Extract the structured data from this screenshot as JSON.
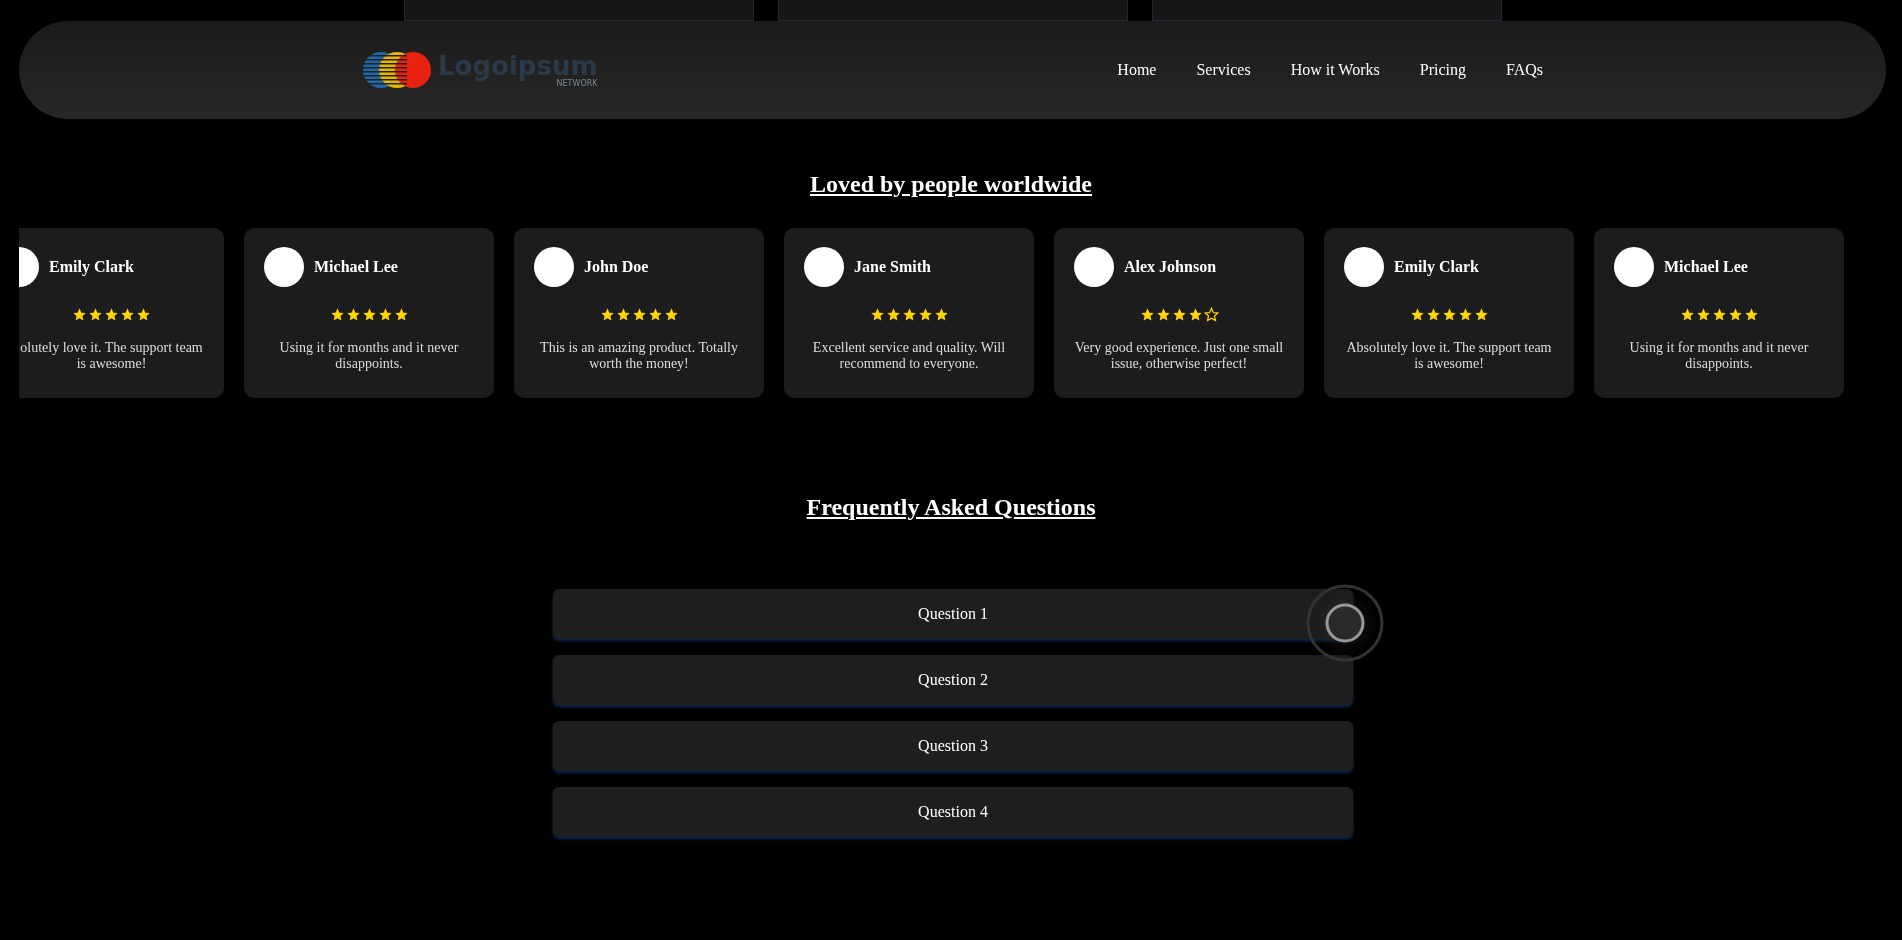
{
  "logo": {
    "name": "Logoipsum",
    "tagline": "NETWORK"
  },
  "nav": [
    {
      "label": "Home"
    },
    {
      "label": "Services"
    },
    {
      "label": "How it Works"
    },
    {
      "label": "Pricing"
    },
    {
      "label": "FAQs"
    }
  ],
  "testimonials": {
    "title": "Loved by people worldwide",
    "items": [
      {
        "name": "Emily Clark",
        "stars": 5,
        "text": "olutely love it. The support team is awesome!",
        "cut": true
      },
      {
        "name": "Michael Lee",
        "stars": 5,
        "text": "Using it for months and it never disappoints."
      },
      {
        "name": "John Doe",
        "stars": 5,
        "text": "This is an amazing product. Totally worth the money!"
      },
      {
        "name": "Jane Smith",
        "stars": 5,
        "text": "Excellent service and quality. Will recommend to everyone."
      },
      {
        "name": "Alex Johnson",
        "stars": 4,
        "text": "Very good experience. Just one small issue, otherwise perfect!"
      },
      {
        "name": "Emily Clark",
        "stars": 5,
        "text": "Absolutely love it. The support team is awesome!"
      },
      {
        "name": "Michael Lee",
        "stars": 5,
        "text": "Using it for months and it never disappoints."
      }
    ]
  },
  "faq": {
    "title": "Frequently Asked Questions",
    "items": [
      {
        "question": "Question 1"
      },
      {
        "question": "Question 2"
      },
      {
        "question": "Question 3"
      },
      {
        "question": "Question 4"
      }
    ]
  }
}
